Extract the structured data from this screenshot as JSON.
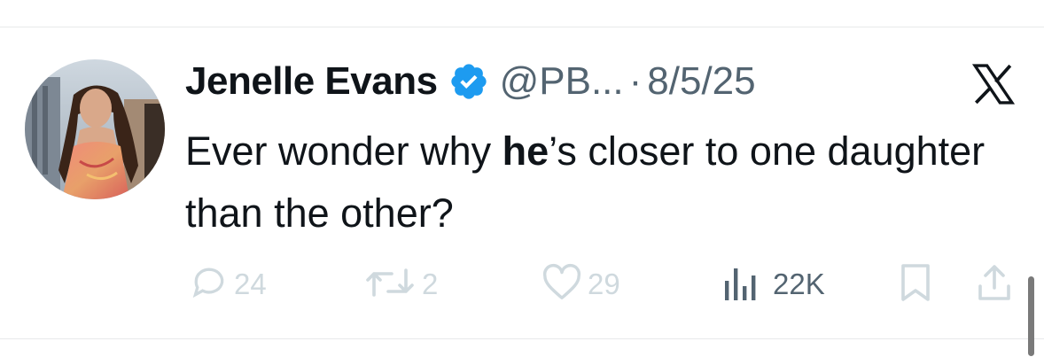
{
  "tweet": {
    "author_name": "Jenelle Evans",
    "handle": "@PB...",
    "separator": "·",
    "date": "8/5/25",
    "text_before": "Ever wonder why ",
    "text_bold": "he",
    "text_after": "’s closer to one daughter than the other?"
  },
  "actions": {
    "replies": "24",
    "reposts": "2",
    "likes": "29",
    "views": "22K"
  },
  "icons": {
    "verified": "verified-badge-icon",
    "platform": "x-logo-icon",
    "reply": "reply-icon",
    "repost": "repost-icon",
    "like": "heart-icon",
    "views": "views-icon",
    "bookmark": "bookmark-icon",
    "share": "share-icon"
  },
  "colors": {
    "verified": "#1d9bf0",
    "text": "#0f1419",
    "muted": "#536471",
    "faded": "#cfd9de"
  }
}
